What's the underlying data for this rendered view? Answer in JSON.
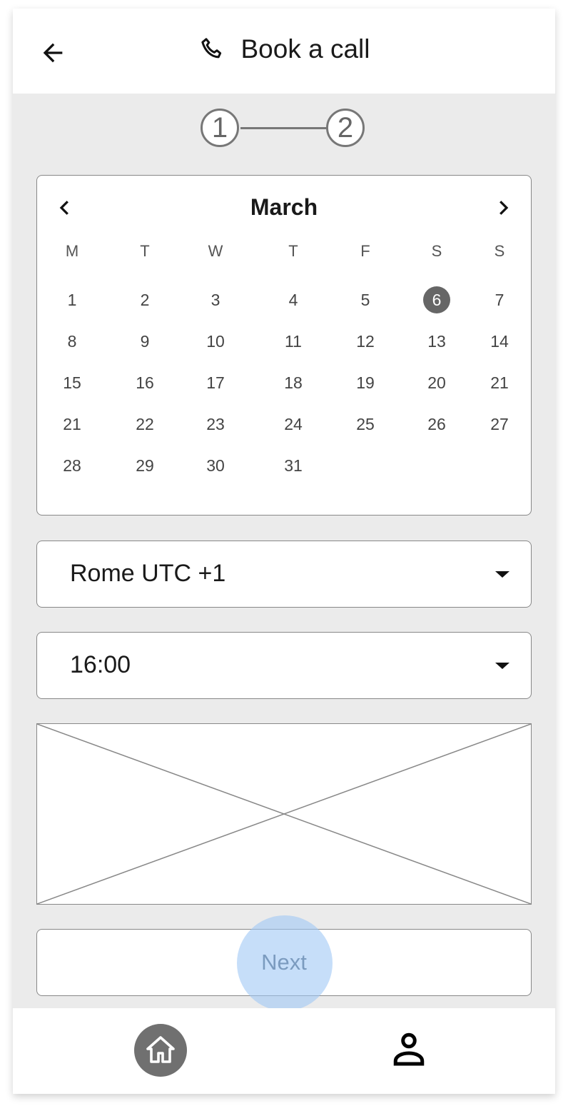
{
  "header": {
    "title": "Book a call",
    "back_icon": "arrow-left-icon",
    "title_icon": "phone-icon"
  },
  "stepper": {
    "steps": [
      "1",
      "2"
    ],
    "current": 1
  },
  "calendar": {
    "month": "March",
    "weekdays": [
      "M",
      "T",
      "W",
      "T",
      "F",
      "S",
      "S"
    ],
    "weeks": [
      [
        "1",
        "2",
        "3",
        "4",
        "5",
        "6",
        "7"
      ],
      [
        "8",
        "9",
        "10",
        "11",
        "12",
        "13",
        "14"
      ],
      [
        "15",
        "16",
        "17",
        "18",
        "19",
        "20",
        "21"
      ],
      [
        "21",
        "22",
        "23",
        "24",
        "25",
        "26",
        "27"
      ],
      [
        "28",
        "29",
        "30",
        "31",
        "",
        "",
        ""
      ]
    ],
    "selected": "6"
  },
  "timezone": {
    "value": "Rome UTC +1"
  },
  "time": {
    "value": "16:00"
  },
  "next_button": {
    "label": "Next"
  },
  "bottom_nav": {
    "items": [
      {
        "icon": "home-icon",
        "active": true
      },
      {
        "icon": "user-icon",
        "active": false
      }
    ]
  },
  "colors": {
    "background": "#ebebeb",
    "selected_day": "#666666",
    "touch_highlight": "#a0c8f5"
  }
}
